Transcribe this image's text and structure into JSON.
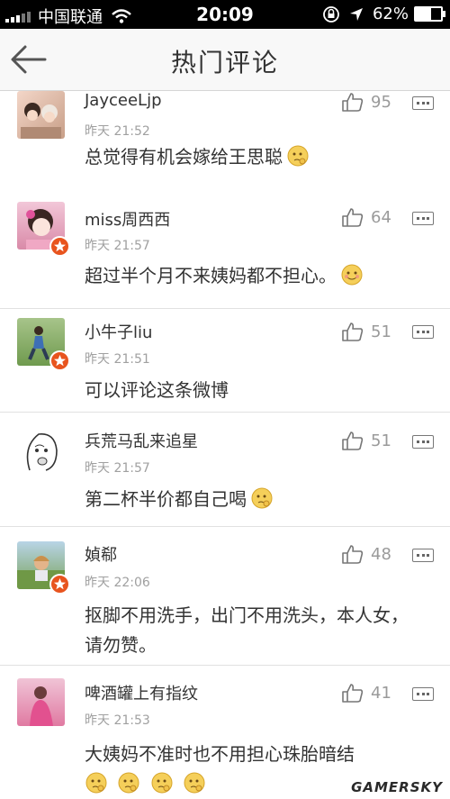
{
  "status_bar": {
    "carrier": "中国联通",
    "time": "20:09",
    "battery": "62%",
    "battery_level": 0.62
  },
  "nav": {
    "title": "热门评论"
  },
  "comments": [
    {
      "name": "JayceeLjp",
      "time": "昨天 21:52",
      "likes": "95",
      "text": "总觉得有机会嫁给王思聪",
      "emojis": 1,
      "verified": false
    },
    {
      "name": "miss周西西",
      "time": "昨天 21:57",
      "likes": "64",
      "text": "超过半个月不来姨妈都不担心。",
      "emojis": 1,
      "verified": true
    },
    {
      "name": "小牛子liu",
      "time": "昨天 21:51",
      "likes": "51",
      "text": "可以评论这条微博",
      "emojis": 0,
      "verified": true
    },
    {
      "name": "兵荒马乱来追星",
      "time": "昨天 21:57",
      "likes": "51",
      "text": "第二杯半价都自己喝",
      "emojis": 1,
      "verified": false
    },
    {
      "name": "媜郗",
      "time": "昨天 22:06",
      "likes": "48",
      "text": "抠脚不用洗手，出门不用洗头，本人女，请勿赞。",
      "emojis": 0,
      "verified": true
    },
    {
      "name": "啤酒罐上有指纹",
      "time": "昨天 21:53",
      "likes": "41",
      "text": "大姨妈不准时也不用担心珠胎暗结",
      "emojis": 4,
      "verified": false
    }
  ],
  "watermark": "GAMERSKY"
}
